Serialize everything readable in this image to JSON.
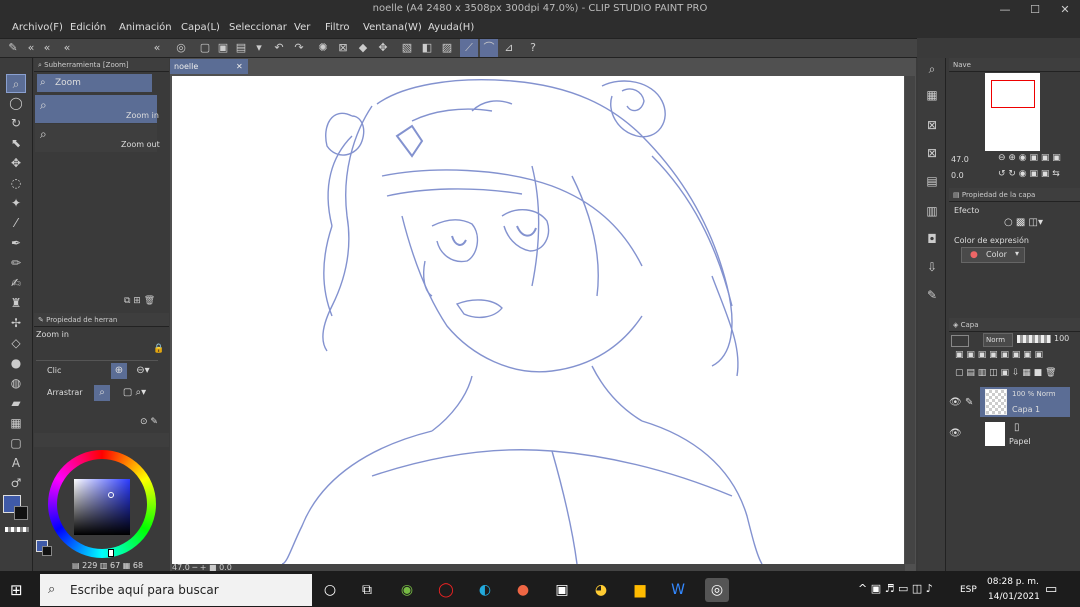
{
  "window": {
    "title": "noelle (A4 2480 x 3508px 300dpi 47.0%) - CLIP STUDIO PAINT PRO",
    "min": "—",
    "max": "☐",
    "close": "✕"
  },
  "menu": [
    "Archivo(F)",
    "Edición",
    "Animación",
    "Capa(L)",
    "Seleccionar",
    "Ver",
    "Filtro",
    "Ventana(W)",
    "Ayuda(H)"
  ],
  "subtool": {
    "header": "Subherramienta [Zoom]",
    "group": "Zoom",
    "items": [
      {
        "label": "Zoom in"
      },
      {
        "label": "Zoom out"
      }
    ]
  },
  "toolprops": {
    "header": "Propiedad de herran",
    "title": "Zoom in",
    "clic_label": "Clic",
    "arrastrar_label": "Arrastrar"
  },
  "color": {
    "main": "#3f5aa8",
    "sub": "#111111",
    "hue_value": "229",
    "sat_value": "67",
    "val_value": "68"
  },
  "canvas": {
    "tab": "noelle",
    "zoom": "47.0",
    "angle": "0.0"
  },
  "navigator": {
    "header": "Nave",
    "zoom": "47.0",
    "angle": "0.0"
  },
  "layerprops": {
    "header": "Propiedad de la capa",
    "effect_label": "Efecto",
    "expr_label": "Color de expresión",
    "expr_value": "Color"
  },
  "layers": {
    "header": "Capa",
    "blend": "Norm",
    "opacity": "100",
    "items": [
      {
        "info": "100 % Norm",
        "name": "Capa 1"
      },
      {
        "info": "",
        "name": "Papel"
      }
    ]
  },
  "taskbar": {
    "search_placeholder": "Escribe aquí para buscar",
    "lang": "ESP",
    "time": "08:28 p. m.",
    "date": "14/01/2021"
  }
}
